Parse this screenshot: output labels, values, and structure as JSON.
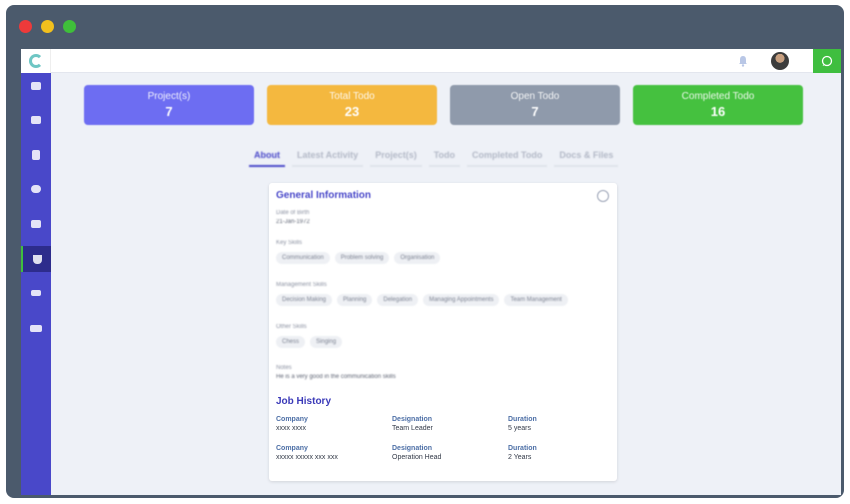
{
  "window": {
    "controls": [
      "close",
      "minimize",
      "maximize"
    ]
  },
  "topbar": {
    "icons": [
      "bell-icon",
      "avatar",
      "chat-icon"
    ]
  },
  "sidebar": {
    "items": [
      {
        "icon": "home-icon"
      },
      {
        "icon": "list-icon"
      },
      {
        "icon": "document-icon"
      },
      {
        "icon": "cloud-icon"
      },
      {
        "icon": "pages-icon"
      },
      {
        "icon": "trophy-icon",
        "active": true
      },
      {
        "icon": "share-icon"
      },
      {
        "icon": "card-icon"
      }
    ]
  },
  "stats": [
    {
      "label": "Project(s)",
      "value": "7",
      "color": "#6d6df2"
    },
    {
      "label": "Total Todo",
      "value": "23",
      "color": "#f4b83f"
    },
    {
      "label": "Open Todo",
      "value": "7",
      "color": "#8f9aab"
    },
    {
      "label": "Completed Todo",
      "value": "16",
      "color": "#45c13f"
    }
  ],
  "tabs": [
    "About",
    "Latest Activity",
    "Project(s)",
    "Todo",
    "Completed Todo",
    "Docs & Files"
  ],
  "general": {
    "title": "General Information",
    "dob_label": "Date of Birth",
    "dob_value": "21-Jan-1972",
    "key_skills_label": "Key Skills",
    "key_skills": [
      "Communication",
      "Problem solving",
      "Organisation"
    ],
    "mgmt_skills_label": "Management Skills",
    "mgmt_skills": [
      "Decision Making",
      "Planning",
      "Delegation",
      "Managing Appointments",
      "Team Management"
    ],
    "other_skills_label": "Other Skills",
    "other_skills": [
      "Chess",
      "Singing"
    ],
    "notes_label": "Notes",
    "notes_value": "He is a very good in the communication skills"
  },
  "job_history": {
    "title": "Job History",
    "col_company": "Company",
    "col_designation": "Designation",
    "col_duration": "Duration",
    "rows": [
      {
        "company": "xxxx xxxx",
        "designation": "Team Leader",
        "duration": "5 years"
      },
      {
        "company": "xxxxx xxxxx xxx xxx",
        "designation": "Operation Head",
        "duration": "2 Years"
      }
    ]
  },
  "colors": {
    "accent": "#4948c9",
    "sidebar": "#4948c9",
    "chat": "#3fbe3f"
  }
}
